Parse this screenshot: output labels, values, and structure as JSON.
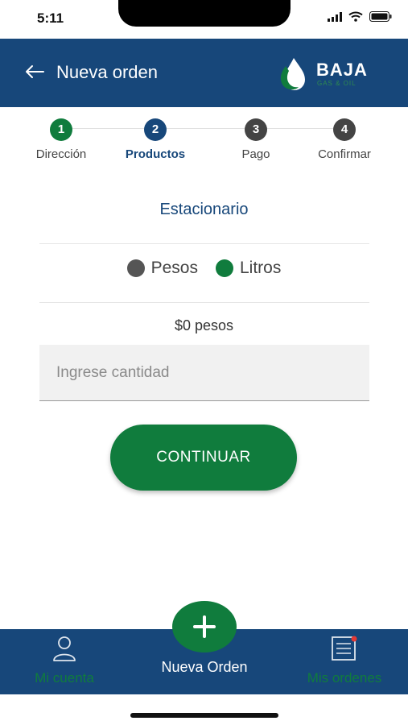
{
  "status_bar": {
    "time": "5:11"
  },
  "header": {
    "title": "Nueva orden",
    "logo_text": "BAJA",
    "logo_subtext": "GAS & OIL"
  },
  "stepper": {
    "steps": [
      {
        "number": "1",
        "label": "Dirección",
        "color": "#107c3d"
      },
      {
        "number": "2",
        "label": "Productos",
        "color": "#17477a"
      },
      {
        "number": "3",
        "label": "Pago",
        "color": "#444444"
      },
      {
        "number": "4",
        "label": "Confirmar",
        "color": "#444444"
      }
    ],
    "active_step": 2
  },
  "main": {
    "section_title": "Estacionario",
    "unit_options": [
      {
        "label": "Pesos",
        "color": "#555555"
      },
      {
        "label": "Litros",
        "color": "#107c3d"
      }
    ],
    "price_text": "$0 pesos",
    "quantity": {
      "value": "",
      "placeholder": "Ingrese cantidad"
    },
    "continue_label": "CONTINUAR"
  },
  "bottom_nav": {
    "account_label": "Mi cuenta",
    "new_order_label": "Nueva Orden",
    "orders_label": "Mis ordenes"
  },
  "colors": {
    "brand_blue": "#17477a",
    "brand_green": "#107c3d"
  }
}
